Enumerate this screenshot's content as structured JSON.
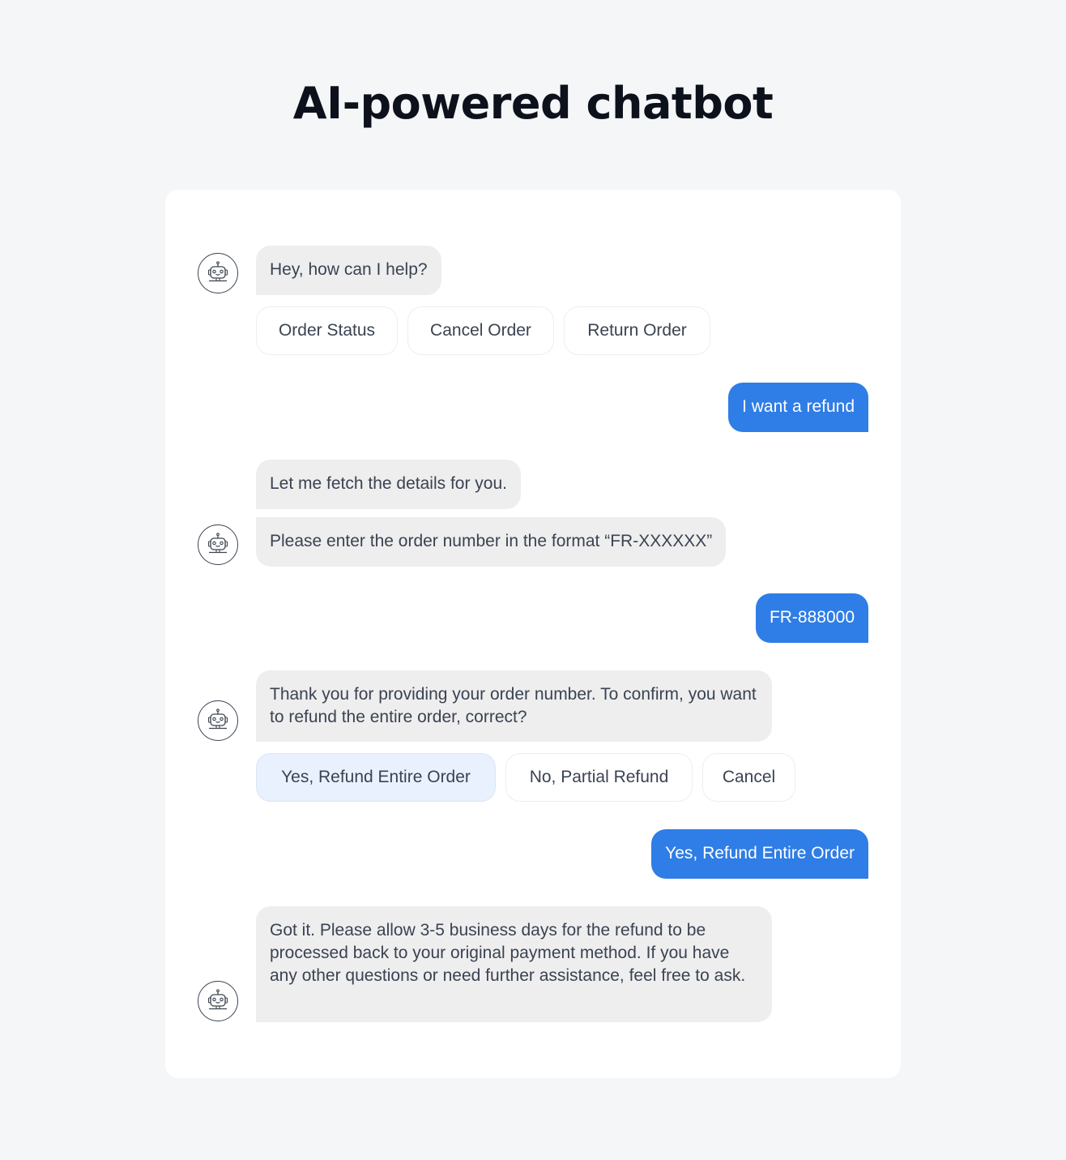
{
  "title": "AI-powered chatbot",
  "colors": {
    "page_bg": "#f5f6f8",
    "card_bg": "#ffffff",
    "bot_bubble": "#eeeeef",
    "user_bubble": "#2f7de6",
    "selected_chip": "#e8f1fd",
    "text": "#3a4351"
  },
  "avatar_icon": "robot-icon",
  "messages": [
    {
      "from": "bot",
      "text": "Hey, how can I help?"
    },
    {
      "from": "bot",
      "type": "quick_replies",
      "options": [
        "Order Status",
        "Cancel Order",
        "Return Order"
      ]
    },
    {
      "from": "user",
      "text": "I want a refund"
    },
    {
      "from": "bot",
      "text": "Let me fetch the details for you."
    },
    {
      "from": "bot",
      "text": "Please enter the order number in the format “FR-XXXXXX”"
    },
    {
      "from": "user",
      "text": "FR-888000"
    },
    {
      "from": "bot",
      "text": "Thank you for providing your order number. To confirm, you want to refund the entire order, correct?"
    },
    {
      "from": "bot",
      "type": "quick_replies",
      "options": [
        "Yes, Refund Entire Order",
        "No, Partial Refund",
        "Cancel"
      ],
      "selected": 0
    },
    {
      "from": "user",
      "text": "Yes, Refund Entire Order"
    },
    {
      "from": "bot",
      "text": "Got it. Please allow 3-5 business days for the refund to be processed back to your original payment method. If you have any other questions or need further assistance, feel free to ask."
    }
  ]
}
